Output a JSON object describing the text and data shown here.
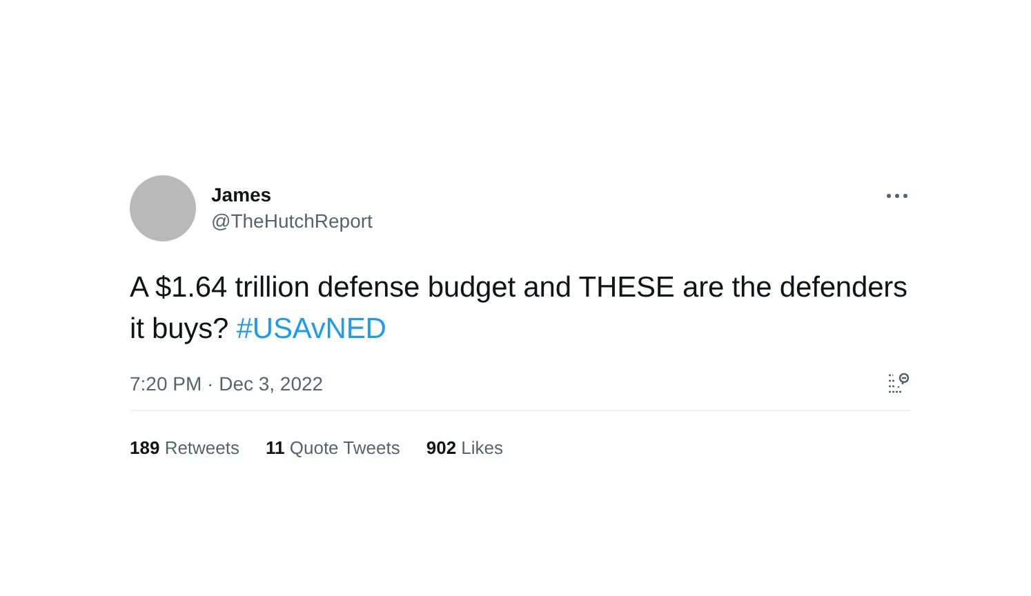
{
  "tweet": {
    "author_name": "James",
    "handle": "@TheHutchReport",
    "text": "A $1.64 trillion defense budget and THESE are the defenders it buys?",
    "hashtag": "#USAvNED",
    "timestamp": "7:20 PM · Dec 3, 2022"
  },
  "stats": [
    {
      "label": "**189** Retweets"
    },
    {
      "label": "**11** Quote Tweets"
    },
    {
      "label": "**902** Likes"
    }
  ]
}
